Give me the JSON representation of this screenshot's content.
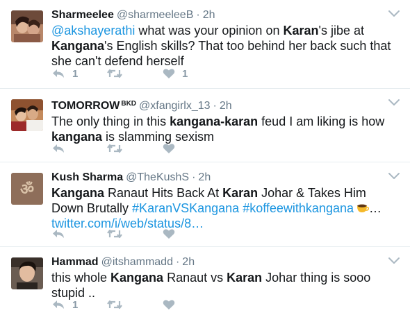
{
  "tweets": [
    {
      "fullname": "Sharmeelee",
      "badge": "",
      "username": "@sharmeeleeB",
      "separator": "·",
      "time": "2h",
      "text": {
        "mention": "@akshayerathi",
        "p1": " what was your opinion on ",
        "b1": "Karan",
        "p2": "'s jibe at ",
        "b2": "Kangana",
        "p3": "'s English skills? That too behind her back such that she can't defend herself"
      },
      "reply_count": "1",
      "retweet_count": "",
      "like_count": "1"
    },
    {
      "fullname": "TOMORROW",
      "badge": "BKD",
      "username": "@xfangirlx_13",
      "separator": "·",
      "time": "2h",
      "text": {
        "p1": "The only thing in this ",
        "b1": "kangana-karan",
        "p2": " feud I am liking is how ",
        "b2": "kangana",
        "p3": " is slamming sexism"
      },
      "reply_count": "",
      "retweet_count": "",
      "like_count": ""
    },
    {
      "fullname": "Kush Sharma",
      "badge": "",
      "username": "@TheKushS",
      "separator": "·",
      "time": "2h",
      "text": {
        "b1": "Kangana",
        "p1": " Ranaut Hits Back At ",
        "b2": "Karan",
        "p2": " Johar & Takes Him Down Brutally ",
        "hashtag1": "#KaranVSKangana",
        "space": " ",
        "hashtag2": "#koffeewithkangana",
        "ellipsis": "…",
        "link": "twitter.com/i/web/status/8…"
      },
      "reply_count": "",
      "retweet_count": "",
      "like_count": ""
    },
    {
      "fullname": "Hammad",
      "badge": "",
      "username": "@itshammadd",
      "separator": "·",
      "time": "2h",
      "text": {
        "p1": "this whole ",
        "b1": "Kangana",
        "p2": " Ranaut vs ",
        "b2": "Karan",
        "p3": " Johar thing is sooo stupid .."
      },
      "reply_count": "1",
      "retweet_count": "",
      "like_count": ""
    }
  ],
  "icons": {
    "reply": "reply-icon",
    "retweet": "retweet-icon",
    "like": "heart-icon",
    "caret": "chevron-down-icon",
    "emoji": "coffee-cup-emoji"
  },
  "colors": {
    "link": "#1b95e0",
    "text": "#14171a",
    "muted": "#657786",
    "action_icon": "#aab8c2",
    "divider": "#e6ecf0"
  }
}
